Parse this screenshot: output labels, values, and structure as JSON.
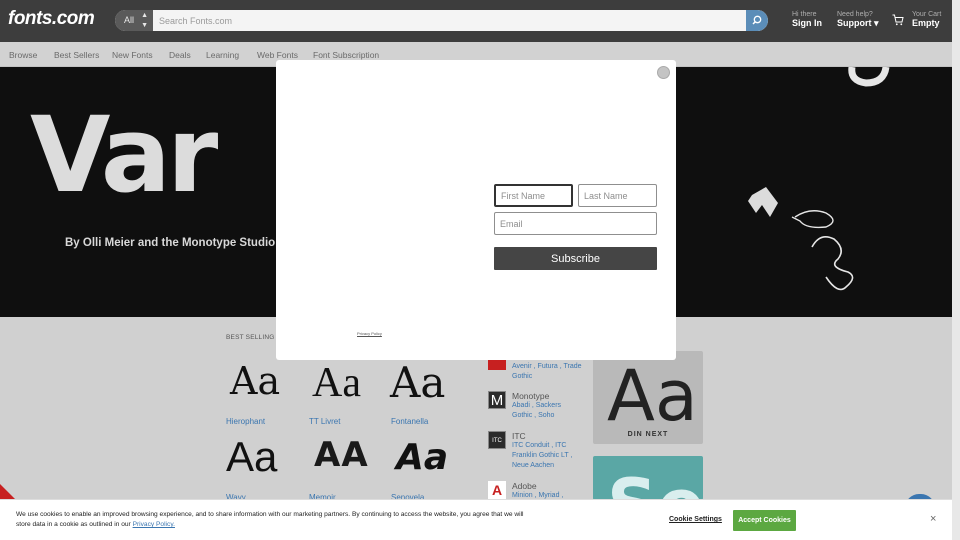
{
  "header": {
    "logo": "fonts.com",
    "search_category": "All",
    "search_placeholder": "Search Fonts.com",
    "sign_in_small": "Hi there",
    "sign_in_big": "Sign In",
    "support_small": "Need help?",
    "support_big": "Support ▾",
    "cart_small": "Your Cart",
    "cart_big": "Empty"
  },
  "nav": [
    "Browse",
    "Best Sellers",
    "New Fonts",
    "Deals",
    "Learning",
    "Web Fonts",
    "Font Subscription"
  ],
  "hero": {
    "title": "Var",
    "subtitle": "By Olli Meier and the Monotype Studio."
  },
  "section_heading": "BEST SELLING NE",
  "fonts": [
    {
      "sample": "Aa",
      "name": "Hierophant"
    },
    {
      "sample": "Aa",
      "name": "TT Livret"
    },
    {
      "sample": "Aa",
      "name": "Fontanella"
    },
    {
      "sample": "Aa",
      "name": "Wavy"
    },
    {
      "sample": "AA",
      "name": "Memoir"
    },
    {
      "sample": "Aa",
      "name": "Senovela"
    }
  ],
  "foundries": [
    {
      "name": "",
      "links": "Avenir , Futura , Trade Gothic",
      "logo_color": "#c72020",
      "logo_text": ""
    },
    {
      "name": "Monotype",
      "links": "Abadi , Sackers Gothic , Soho",
      "logo_color": "#2b2b2b",
      "logo_text": "M"
    },
    {
      "name": "ITC",
      "links": "ITC Conduit , ITC Franklin Gothic LT , Neue Aachen",
      "logo_color": "#2b2b2b",
      "logo_text": "ITC"
    },
    {
      "name": "Adobe",
      "links": "Minion , Myriad ,",
      "logo_color": "#c72020",
      "logo_text": "A"
    }
  ],
  "promos": [
    {
      "sample": "Aa",
      "label": "DIN NEXT",
      "color": "#b9b9b9"
    },
    {
      "sample": "Se",
      "label": "",
      "color": "#5aa7a5"
    }
  ],
  "modal": {
    "first_name_placeholder": "First Name",
    "last_name_placeholder": "Last Name",
    "email_placeholder": "Email",
    "subscribe_label": "Subscribe",
    "privacy_label": "Privacy Policy"
  },
  "cookie": {
    "text": "We use cookies to enable an improved browsing experience, and to share information with our marketing partners. By continuing to access the website, you agree that we will store data in a cookie as outlined in our ",
    "link": "Privacy Policy.",
    "settings_label": "Cookie Settings",
    "accept_label": "Accept Cookies",
    "close_label": "×"
  }
}
